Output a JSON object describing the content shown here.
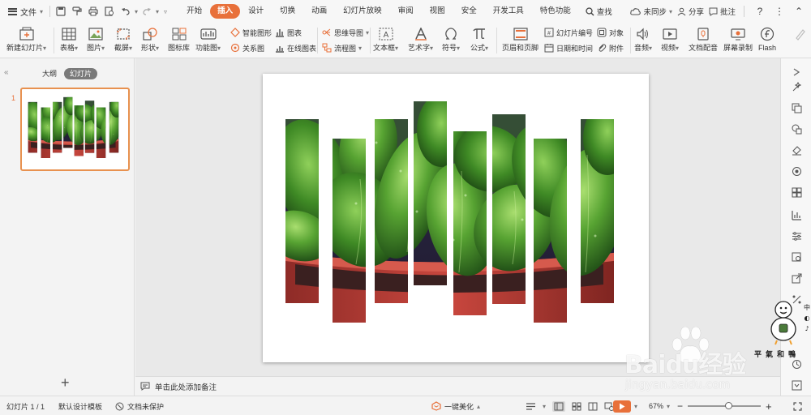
{
  "menubar": {
    "file_label": "文件",
    "tabs": [
      {
        "label": "开始",
        "active": false
      },
      {
        "label": "插入",
        "active": true
      },
      {
        "label": "设计",
        "active": false
      },
      {
        "label": "切换",
        "active": false
      },
      {
        "label": "动画",
        "active": false
      },
      {
        "label": "幻灯片放映",
        "active": false
      },
      {
        "label": "审阅",
        "active": false
      },
      {
        "label": "视图",
        "active": false
      },
      {
        "label": "安全",
        "active": false
      },
      {
        "label": "开发工具",
        "active": false
      },
      {
        "label": "特色功能",
        "active": false
      }
    ],
    "search_label": "查找",
    "sync_label": "未同步",
    "share_label": "分享",
    "comment_label": "批注",
    "help_label": "?",
    "accent": "#e8703a"
  },
  "ribbon": {
    "new_slide": "新建幻灯片",
    "table": "表格",
    "picture": "图片",
    "screenshot": "截屏",
    "shape": "形状",
    "icon_lib": "图标库",
    "func_chart": "功能图",
    "smart_shape": "智能图形",
    "chart": "图表",
    "relation": "关系图",
    "online_chart": "在线图表",
    "mindmap": "思维导图",
    "flowchart": "流程图",
    "textbox": "文本框",
    "wordart": "艺术字",
    "symbol": "符号",
    "formula": "公式",
    "header_footer": "页眉和页脚",
    "slide_number": "幻灯片编号",
    "object": "对象",
    "datetime": "日期和时间",
    "attachment": "附件",
    "audio": "音频",
    "video": "视频",
    "doc_dub": "文档配音",
    "screen_record": "屏幕录制",
    "flash": "Flash"
  },
  "leftpanel": {
    "tab_outline": "大纲",
    "tab_slides": "幻灯片",
    "slide_number": "1",
    "add_icon": "+"
  },
  "notes": {
    "placeholder": "单击此处添加备注"
  },
  "statusbar": {
    "slide_count": "幻灯片 1 / 1",
    "template": "默认设计模板",
    "protect": "文档未保护",
    "beautify": "一键美化",
    "zoom": "67%",
    "zoom_level": 0.55,
    "minus": "−",
    "plus": "+"
  },
  "watermark": {
    "brand": "Baidu经验",
    "url": "jingyan.baidu.com",
    "sticker": "平氣和鴨"
  },
  "colors": {
    "leaf_dark": "#1f4a14",
    "leaf_mid": "#3f8a25",
    "leaf_light": "#7cc24a",
    "pot": "#b23a33",
    "soil": "#3a2020",
    "bg_purple": "#2a2440"
  }
}
